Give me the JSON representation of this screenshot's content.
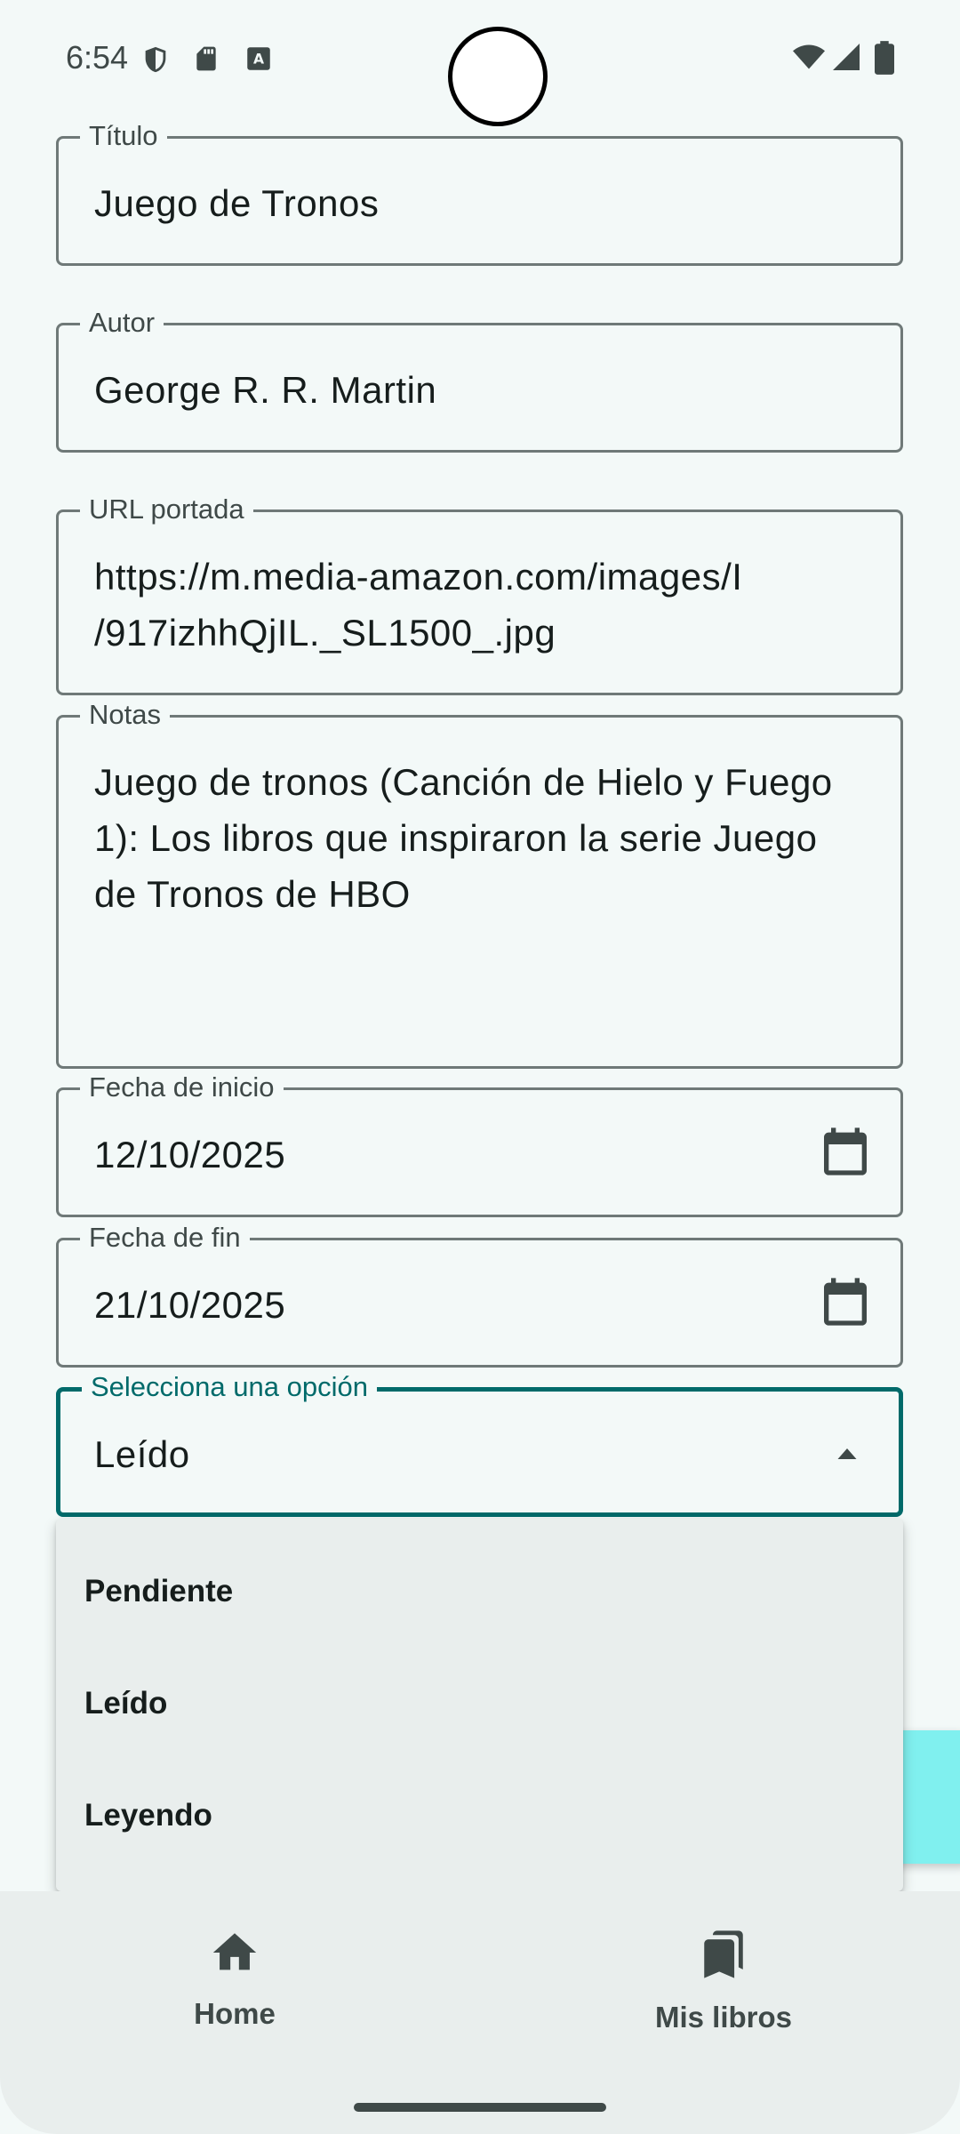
{
  "status_bar": {
    "time": "6:54"
  },
  "form": {
    "title": {
      "label": "Título",
      "value": "Juego de Tronos"
    },
    "author": {
      "label": "Autor",
      "value": "George R. R. Martin"
    },
    "cover_url": {
      "label": "URL portada",
      "value_line1": "https://m.media-amazon.com/images/I",
      "value_line2": "/917izhhQjIL._SL1500_.jpg"
    },
    "notes": {
      "label": "Notas",
      "value_line1": "Juego de tronos (Canción de Hielo y Fuego",
      "value_line2": "1): Los libros que inspiraron la serie Juego",
      "value_line3": "de Tronos de HBO"
    },
    "start_date": {
      "label": "Fecha de inicio",
      "value": "12/10/2025"
    },
    "end_date": {
      "label": "Fecha de fin",
      "value": "21/10/2025"
    },
    "status": {
      "label": "Selecciona una opción",
      "value": "Leído"
    }
  },
  "status_menu": {
    "options": [
      "Pendiente",
      "Leído",
      "Leyendo"
    ]
  },
  "bottom_nav": {
    "items": [
      {
        "label": "Home",
        "icon": "home-icon"
      },
      {
        "label": "Mis libros",
        "icon": "bookmarks-icon"
      }
    ]
  },
  "colors": {
    "accent": "#006a6a",
    "background": "#f3f9f8",
    "surface": "#e9eeed",
    "fab": "#80f0ef"
  }
}
